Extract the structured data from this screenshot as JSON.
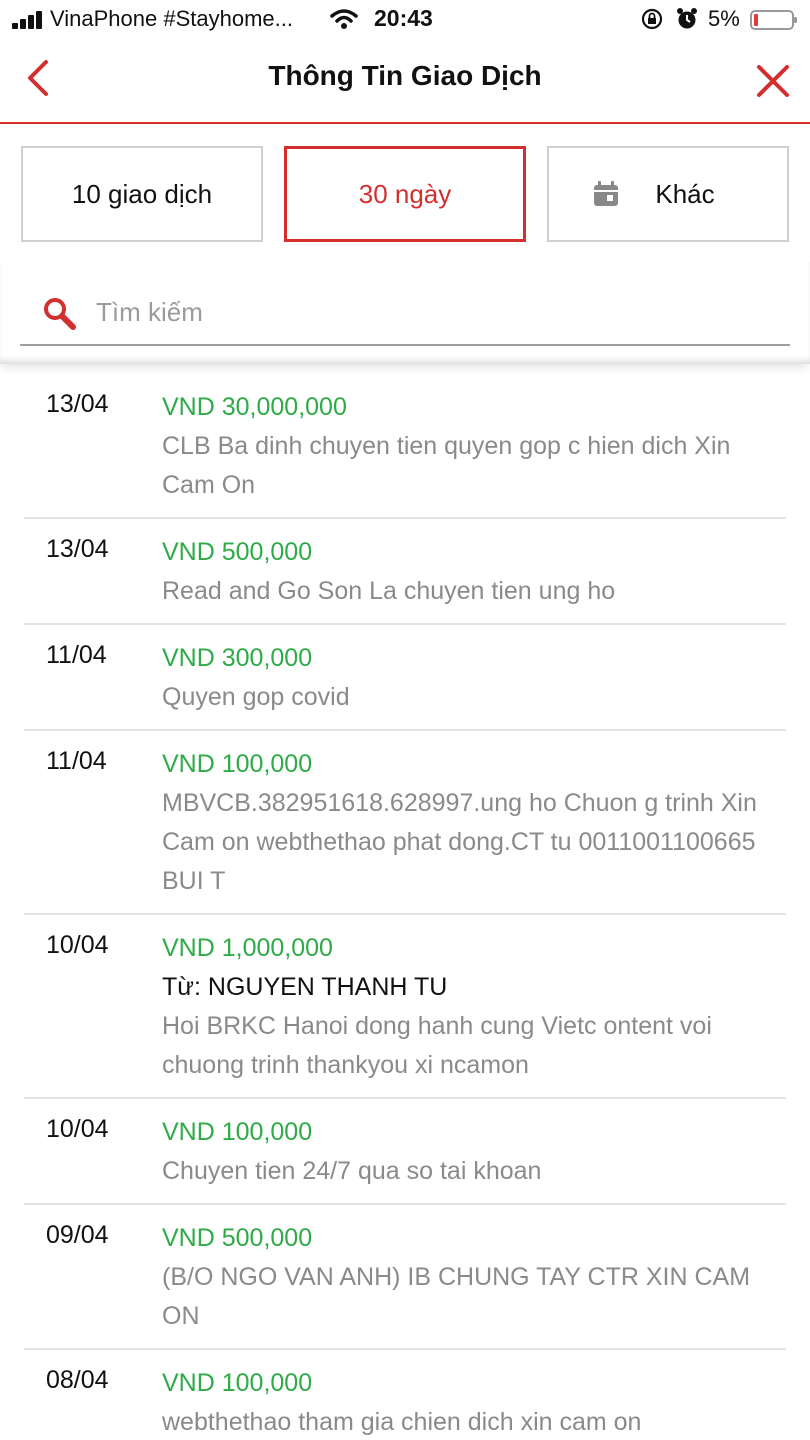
{
  "status_bar": {
    "carrier": "VinaPhone #Stayhome...",
    "time": "20:43",
    "battery": "5%"
  },
  "header": {
    "title": "Thông Tin Giao Dịch"
  },
  "filters": {
    "tab1": "10 giao dịch",
    "tab2": "30 ngày",
    "tab3": "Khác",
    "selected": "30 ngày"
  },
  "search": {
    "placeholder": "Tìm kiếm"
  },
  "transactions": [
    {
      "date": "13/04",
      "amount": "VND 30,000,000",
      "from": "",
      "desc": "CLB Ba dinh chuyen tien quyen gop c hien dich Xin Cam On"
    },
    {
      "date": "13/04",
      "amount": "VND 500,000",
      "from": "",
      "desc": "Read and Go Son La chuyen tien ung ho"
    },
    {
      "date": "11/04",
      "amount": "VND 300,000",
      "from": "",
      "desc": "Quyen gop covid"
    },
    {
      "date": "11/04",
      "amount": "VND 100,000",
      "from": "",
      "desc": "MBVCB.382951618.628997.ung ho Chuon g trinh Xin Cam on webthethao phat dong.CT tu 0011001100665 BUI T"
    },
    {
      "date": "10/04",
      "amount": "VND 1,000,000",
      "from": "Từ: NGUYEN THANH TU",
      "desc": "Hoi BRKC Hanoi dong hanh cung Vietc ontent voi chuong trinh thankyou xi ncamon"
    },
    {
      "date": "10/04",
      "amount": "VND 100,000",
      "from": "",
      "desc": "Chuyen tien 24/7 qua so tai khoan"
    },
    {
      "date": "09/04",
      "amount": "VND 500,000",
      "from": "",
      "desc": "(B/O NGO VAN ANH) IB CHUNG TAY CTR XIN CAM ON"
    },
    {
      "date": "08/04",
      "amount": "VND 100,000",
      "from": "",
      "desc": "webthethao tham gia chien dich xin cam on"
    }
  ],
  "colors": {
    "accent": "#d32f2f",
    "amount": "#2eab47",
    "muted": "#8a8a8a"
  }
}
